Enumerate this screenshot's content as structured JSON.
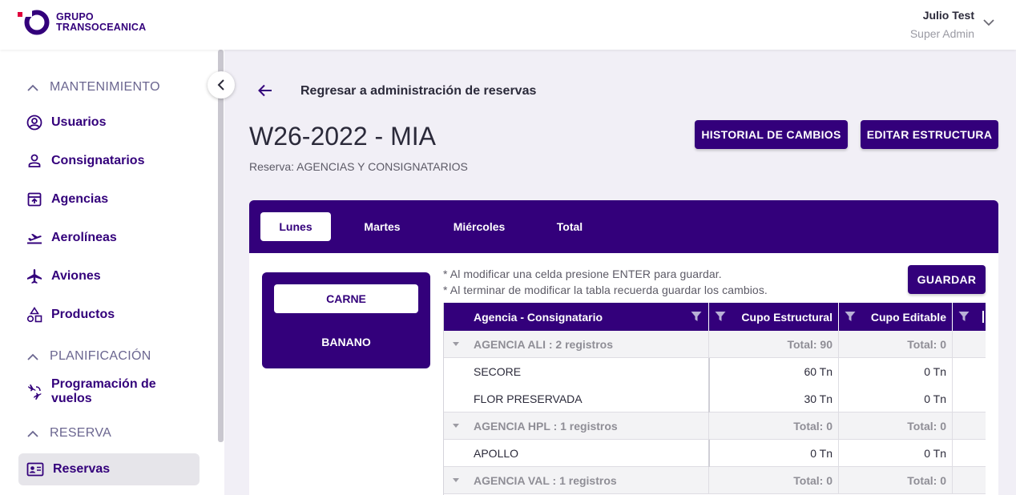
{
  "header": {
    "logo_line1": "GRUPO",
    "logo_line2": "TRANSOCEANICA",
    "user_name": "Julio Test",
    "user_role": "Super Admin",
    "brand_color": "#33007b",
    "logo_accent_color": "#e0003c"
  },
  "sidebar": {
    "sections": [
      {
        "label": "MANTENIMIENTO"
      },
      {
        "label": "PLANIFICACIÓN"
      },
      {
        "label": "RESERVA"
      }
    ],
    "items": [
      {
        "label": "Usuarios",
        "icon": "user-circle-icon"
      },
      {
        "label": "Consignatarios",
        "icon": "person-icon"
      },
      {
        "label": "Agencias",
        "icon": "upload-box-icon"
      },
      {
        "label": "Aerolíneas",
        "icon": "flight-takeoff-icon"
      },
      {
        "label": "Aviones",
        "icon": "airplane-icon"
      },
      {
        "label": "Productos",
        "icon": "shapes-icon"
      },
      {
        "label": "Programación de vuelos",
        "icon": "connecting-flights-icon"
      },
      {
        "label": "Reservas",
        "icon": "id-card-icon",
        "active": true
      }
    ]
  },
  "page": {
    "back_label": "Regresar a administración de reservas",
    "title": "W26-2022 - MIA",
    "subtitle": "Reserva: AGENCIAS Y CONSIGNATARIOS",
    "history_button": "HISTORIAL DE CAMBIOS",
    "edit_button": "EDITAR ESTRUCTURA"
  },
  "tabs": [
    {
      "label": "Lunes",
      "active": true
    },
    {
      "label": "Martes"
    },
    {
      "label": "Miércoles"
    },
    {
      "label": "Total"
    }
  ],
  "products": [
    {
      "label": "CARNE",
      "active": true
    },
    {
      "label": "BANANO"
    }
  ],
  "notes": {
    "line1": "* Al modificar una celda presione ENTER para guardar.",
    "line2": "* Al terminar de modificar la tabla recuerda guardar los cambios.",
    "save_button": "GUARDAR"
  },
  "grid": {
    "columns": [
      "Agencia - Consignatario",
      "Cupo Estructural",
      "Cupo Editable"
    ],
    "rows": [
      {
        "type": "group",
        "label": "AGENCIA ALI : 2 registros",
        "estructural": "Total: 90",
        "editable": "Total: 0"
      },
      {
        "type": "data",
        "label": "SECORE",
        "estructural": "60 Tn",
        "editable": "0 Tn"
      },
      {
        "type": "data",
        "label": "FLOR PRESERVADA",
        "estructural": "30 Tn",
        "editable": "0 Tn"
      },
      {
        "type": "group",
        "label": "AGENCIA HPL : 1 registros",
        "estructural": "Total: 0",
        "editable": "Total: 0"
      },
      {
        "type": "data",
        "label": "APOLLO",
        "estructural": "0 Tn",
        "editable": "0 Tn"
      },
      {
        "type": "group",
        "label": "AGENCIA VAL : 1 registros",
        "estructural": "Total: 0",
        "editable": "Total: 0"
      }
    ]
  }
}
